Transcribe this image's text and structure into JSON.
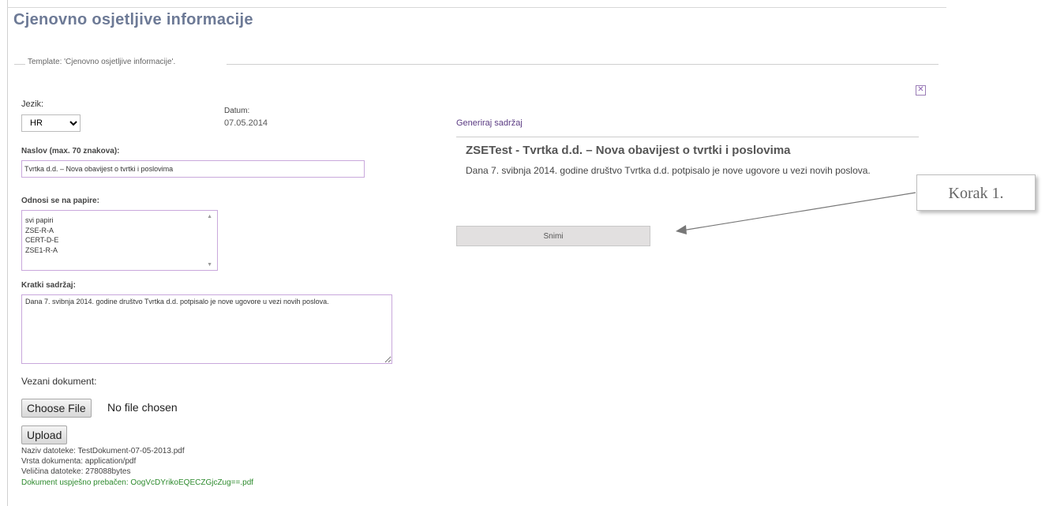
{
  "page": {
    "title": "Cjenovno osjetljive informacije",
    "template_legend": "Template: 'Cjenovno osjetljive informacije'.",
    "close_icon": "✕"
  },
  "form": {
    "language_label": "Jezik:",
    "language_value": "HR",
    "date_label": "Datum:",
    "date_value": "07.05.2014",
    "title_label": "Naslov (max. 70 znakova):",
    "title_value": "Tvrtka d.d. – Nova obavijest o tvrtki i poslovima",
    "papers_label": "Odnosi se na papire:",
    "papers": [
      "svi papiri",
      "ZSE-R-A",
      "CERT-D-E",
      "ZSE1-R-A"
    ],
    "summary_label": "Kratki sadržaj:",
    "summary_value": "Dana 7. svibnja 2014. godine društvo Tvrtka d.d. potpisalo je nove ugovore u vezi novih poslova.",
    "attached_label": "Vezani dokument:",
    "choose_file_label": "Choose File",
    "no_file_label": "No file chosen",
    "upload_label": "Upload",
    "file_name_line": "Naziv datoteke: TestDokument-07-05-2013.pdf",
    "doc_type_line": "Vrsta dokumenta: application/pdf",
    "file_size_line": "Veličina datoteke: 278088bytes",
    "success_line": "Dokument uspješno prebačen: OogVcDYrikoEQECZGjcZug==.pdf"
  },
  "preview": {
    "generate_link": "Generiraj sadržaj",
    "heading": "ZSETest - Tvrtka d.d. – Nova obavijest o tvrtki i poslovima",
    "body": "Dana 7. svibnja 2014. godine društvo Tvrtka d.d. potpisalo je nove ugovore u vezi novih poslova.",
    "save_label": "Snimi"
  },
  "callout": {
    "label": "Korak 1."
  }
}
